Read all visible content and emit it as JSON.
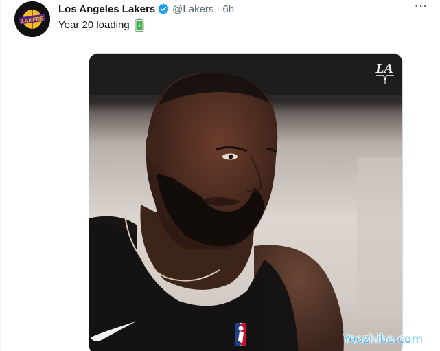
{
  "tweet": {
    "display_name": "Los Angeles Lakers",
    "handle": "@Lakers",
    "separator": "·",
    "time": "6h",
    "text": "Year 20 loading",
    "more_label": "···",
    "avatar_logo_text": "LAKERS",
    "avatar_icon": "lakers-logo",
    "verified_icon": "verified-badge-icon",
    "emoji_icon": "battery-icon",
    "media_logo_text": "LA"
  },
  "watermark": {
    "text": "Yoozhibo.com"
  },
  "colors": {
    "verified": "#1d9bf0",
    "text_primary": "#0f1419",
    "text_secondary": "#536471",
    "lakers_gold": "#fdb927",
    "lakers_purple": "#552583",
    "battery_green": "#3fb04a",
    "watermark": "#4db7f5"
  }
}
